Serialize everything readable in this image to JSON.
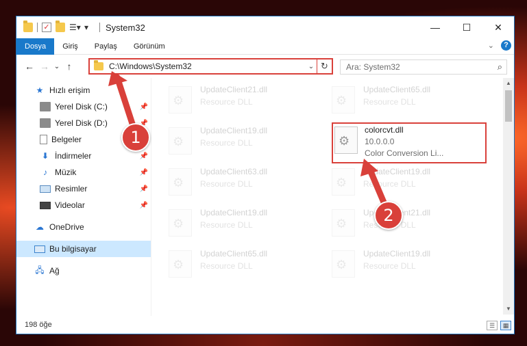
{
  "window": {
    "title": "System32",
    "controls": {
      "minimize": "—",
      "maximize": "☐",
      "close": "✕"
    }
  },
  "ribbon": {
    "tabs": [
      "Dosya",
      "Giriş",
      "Paylaş",
      "Görünüm"
    ],
    "active_tab": "Dosya",
    "help": "?"
  },
  "nav": {
    "address": "C:\\Windows\\System32",
    "search_placeholder": "Ara: System32"
  },
  "sidebar": {
    "items": [
      {
        "label": "Hızlı erişim",
        "icon": "star-icon",
        "pinned": false
      },
      {
        "label": "Yerel Disk (C:)",
        "icon": "drive-icon",
        "pinned": true
      },
      {
        "label": "Yerel Disk (D:)",
        "icon": "drive-icon",
        "pinned": true
      },
      {
        "label": "Belgeler",
        "icon": "document-icon",
        "pinned": true
      },
      {
        "label": "İndirmeler",
        "icon": "download-icon",
        "pinned": true
      },
      {
        "label": "Müzik",
        "icon": "music-icon",
        "pinned": true
      },
      {
        "label": "Resimler",
        "icon": "pictures-icon",
        "pinned": true
      },
      {
        "label": "Videolar",
        "icon": "videos-icon",
        "pinned": true
      },
      {
        "label": "OneDrive",
        "icon": "cloud-icon",
        "pinned": false
      },
      {
        "label": "Bu bilgisayar",
        "icon": "computer-icon",
        "pinned": false,
        "selected": true
      },
      {
        "label": "Ağ",
        "icon": "network-icon",
        "pinned": false
      }
    ]
  },
  "files": [
    {
      "name": "UpdateClient21.dll",
      "type": "Resource DLL",
      "faded": true
    },
    {
      "name": "UpdateClient65.dll",
      "type": "Resource DLL",
      "faded": true
    },
    {
      "name": "UpdateClient19.dll",
      "type": "Resource DLL",
      "faded": true
    },
    {
      "name": "colorcvt.dll",
      "version": "10.0.0.0",
      "type": "Color Conversion Li...",
      "faded": false,
      "highlighted": true
    },
    {
      "name": "UpdateClient63.dll",
      "type": "Resource DLL",
      "faded": true
    },
    {
      "name": "UpdateClient19.dll",
      "type": "Resource DLL",
      "faded": true
    },
    {
      "name": "UpdateClient19.dll",
      "type": "Resource DLL",
      "faded": true
    },
    {
      "name": "UpdateClient21.dll",
      "type": "Resource DLL",
      "faded": true
    },
    {
      "name": "UpdateClient65.dll",
      "type": "Resource DLL",
      "faded": true
    },
    {
      "name": "UpdateClient19.dll",
      "type": "Resource DLL",
      "faded": true
    }
  ],
  "status": {
    "count": "198 öğe"
  },
  "annotations": {
    "step1": "1",
    "step2": "2",
    "color": "#d9403a"
  }
}
